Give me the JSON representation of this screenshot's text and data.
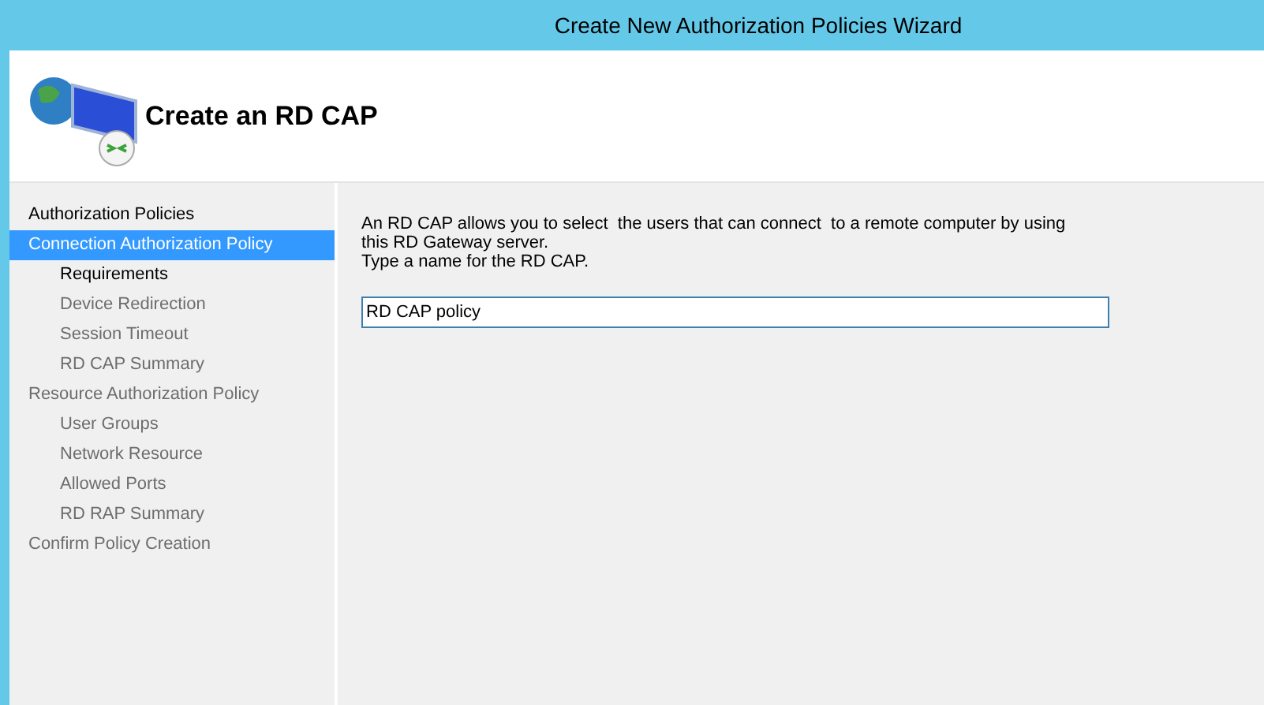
{
  "window": {
    "title": "Create New Authorization Policies Wizard"
  },
  "header": {
    "title": "Create an RD CAP"
  },
  "sidebar": {
    "items": [
      {
        "label": "Authorization Policies",
        "selected": false,
        "active": true
      },
      {
        "label": "Connection Authorization Policy",
        "selected": true,
        "children": [
          {
            "label": "Requirements",
            "selected": false,
            "active": true
          },
          {
            "label": "Device Redirection",
            "selected": false,
            "active": false
          },
          {
            "label": "Session Timeout",
            "selected": false,
            "active": false
          },
          {
            "label": "RD CAP Summary",
            "selected": false,
            "active": false
          }
        ]
      },
      {
        "label": "Resource Authorization Policy",
        "selected": false,
        "active": false,
        "children": [
          {
            "label": "User Groups",
            "selected": false,
            "active": false
          },
          {
            "label": "Network Resource",
            "selected": false,
            "active": false
          },
          {
            "label": "Allowed Ports",
            "selected": false,
            "active": false
          },
          {
            "label": "RD RAP Summary",
            "selected": false,
            "active": false
          }
        ]
      },
      {
        "label": "Confirm Policy Creation",
        "selected": false,
        "active": false
      }
    ]
  },
  "content": {
    "description": "An RD CAP allows you to select  the users that can connect  to a remote computer by using this RD Gateway server.",
    "prompt": "Type a name for the RD CAP.",
    "name_field": {
      "value": "RD CAP policy"
    }
  }
}
